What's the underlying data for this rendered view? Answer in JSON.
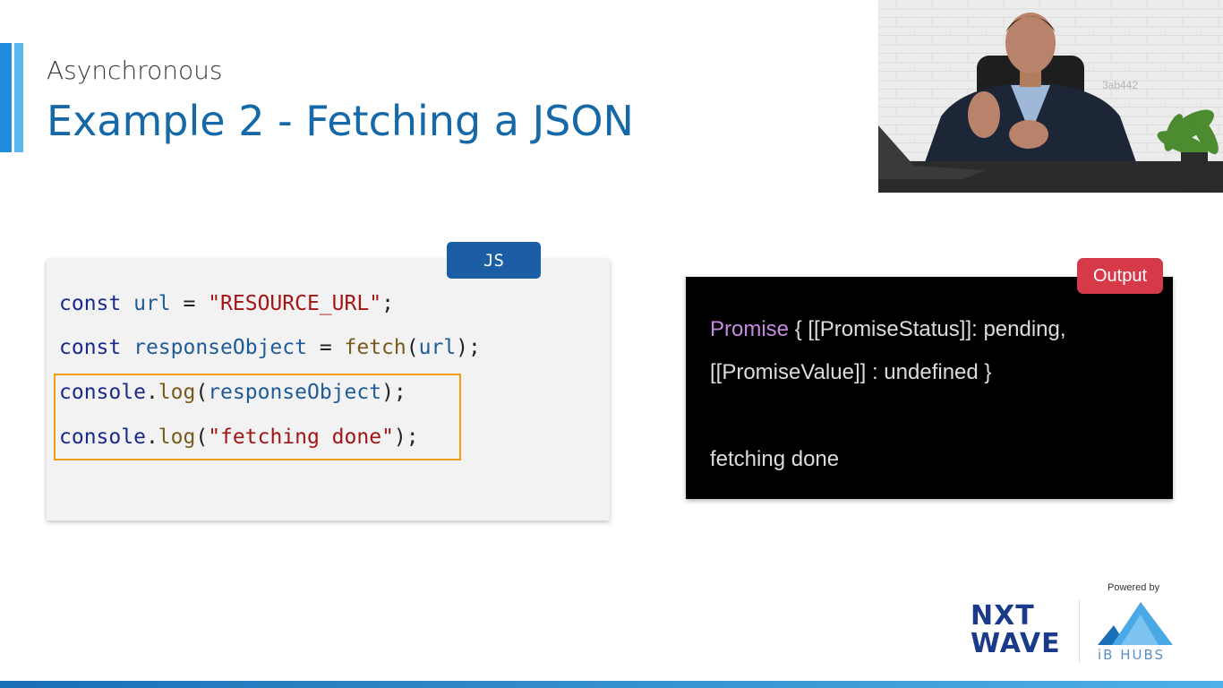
{
  "slide": {
    "subtitle": "Asynchronous",
    "title": "Example 2 - Fetching a JSON"
  },
  "webcam": {
    "watermark": "3ab442"
  },
  "code": {
    "language_badge": "JS",
    "lines": [
      [
        {
          "t": "const ",
          "c": "kw"
        },
        {
          "t": "url",
          "c": "var"
        },
        {
          "t": " = ",
          "c": "pun"
        },
        {
          "t": "\"RESOURCE_URL\"",
          "c": "str"
        },
        {
          "t": ";",
          "c": "pun"
        }
      ],
      [
        {
          "t": "const ",
          "c": "kw"
        },
        {
          "t": "responseObject",
          "c": "var"
        },
        {
          "t": " = ",
          "c": "pun"
        },
        {
          "t": "fetch",
          "c": "fn"
        },
        {
          "t": "(",
          "c": "pun"
        },
        {
          "t": "url",
          "c": "var"
        },
        {
          "t": ");",
          "c": "pun"
        }
      ],
      [
        {
          "t": "console",
          "c": "kw"
        },
        {
          "t": ".",
          "c": "pun"
        },
        {
          "t": "log",
          "c": "fn"
        },
        {
          "t": "(",
          "c": "pun"
        },
        {
          "t": "responseObject",
          "c": "var"
        },
        {
          "t": ");",
          "c": "pun"
        }
      ],
      [
        {
          "t": "console",
          "c": "kw"
        },
        {
          "t": ".",
          "c": "pun"
        },
        {
          "t": "log",
          "c": "fn"
        },
        {
          "t": "(",
          "c": "pun"
        },
        {
          "t": "\"fetching done\"",
          "c": "str"
        },
        {
          "t": ");",
          "c": "pun"
        }
      ]
    ]
  },
  "output": {
    "badge": "Output",
    "line1_keyword": "Promise",
    "line1_rest": " { [[PromiseStatus]]: pending,",
    "line2": "[[PromiseValue]] : undefined }",
    "line3": "fetching done"
  },
  "footer": {
    "nxtwave_line1": "NXT",
    "nxtwave_line2": "WAVE",
    "powered_by": "Powered by",
    "ibhubs": "iB HUBS"
  },
  "colors": {
    "title": "#1669a8",
    "code_badge": "#1b5ea6",
    "output_badge": "#d63a48",
    "highlight": "#f39c12"
  }
}
